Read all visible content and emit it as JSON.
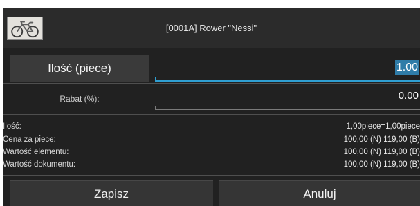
{
  "header": {
    "title": "[0001A] Rower \"Nessi\"",
    "icon": "bicycle-icon"
  },
  "quantity": {
    "button_label": "Ilość (piece)",
    "value": "1.00"
  },
  "discount": {
    "label": "Rabat (%):",
    "value": "0.00"
  },
  "summary": [
    {
      "label": "Ilość:",
      "value": "1,00piece=1,00piece"
    },
    {
      "label": "Cena za piece:",
      "value": "100,00 (N) 119,00 (B)"
    },
    {
      "label": "Wartość elementu:",
      "value": "100,00 (N) 119,00 (B)"
    },
    {
      "label": "Wartość dokumentu:",
      "value": "100,00 (N) 119,00 (B)"
    }
  ],
  "actions": {
    "save_label": "Zapisz",
    "cancel_label": "Anuluj"
  },
  "colors": {
    "background": "#212121",
    "accent": "#2f9fd2",
    "selection": "#2f7ca8",
    "button": "#353535",
    "text": "#ffffff"
  }
}
